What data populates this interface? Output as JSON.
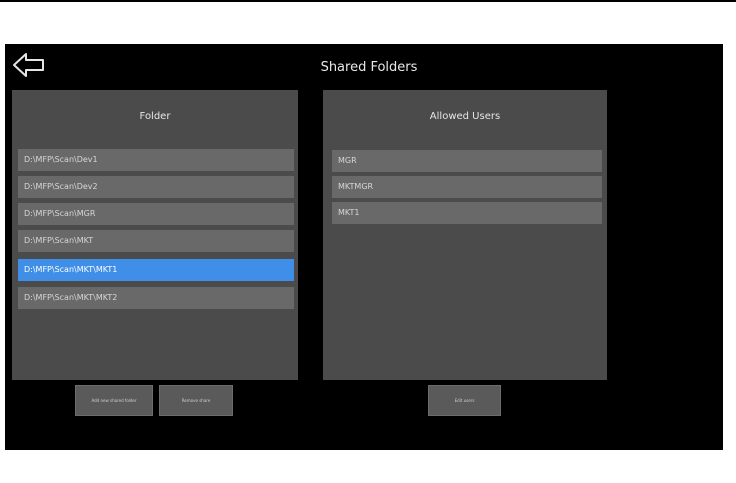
{
  "title": "Shared Folders",
  "back_icon": "back-arrow-icon",
  "folders_panel": {
    "header": "Folder",
    "items": [
      {
        "label": "D:\\MFP\\Scan\\Dev1",
        "selected": false
      },
      {
        "label": "D:\\MFP\\Scan\\Dev2",
        "selected": false
      },
      {
        "label": "D:\\MFP\\Scan\\MGR",
        "selected": false
      },
      {
        "label": "D:\\MFP\\Scan\\MKT",
        "selected": false
      },
      {
        "label": "D:\\MFP\\Scan\\MKT\\MKT1",
        "selected": true
      },
      {
        "label": "D:\\MFP\\Scan\\MKT\\MKT2",
        "selected": false
      }
    ]
  },
  "users_panel": {
    "header": "Allowed Users",
    "items": [
      {
        "label": "MGR"
      },
      {
        "label": "MKTMGR"
      },
      {
        "label": "MKT1"
      }
    ]
  },
  "buttons": {
    "add_folder": "Add new shared folder",
    "remove_folder": "Remove share",
    "edit_users": "Edit users"
  },
  "colors": {
    "background": "#000000",
    "panel": "#4b4b4b",
    "row": "#696969",
    "selected_row": "#3f8fe8"
  }
}
